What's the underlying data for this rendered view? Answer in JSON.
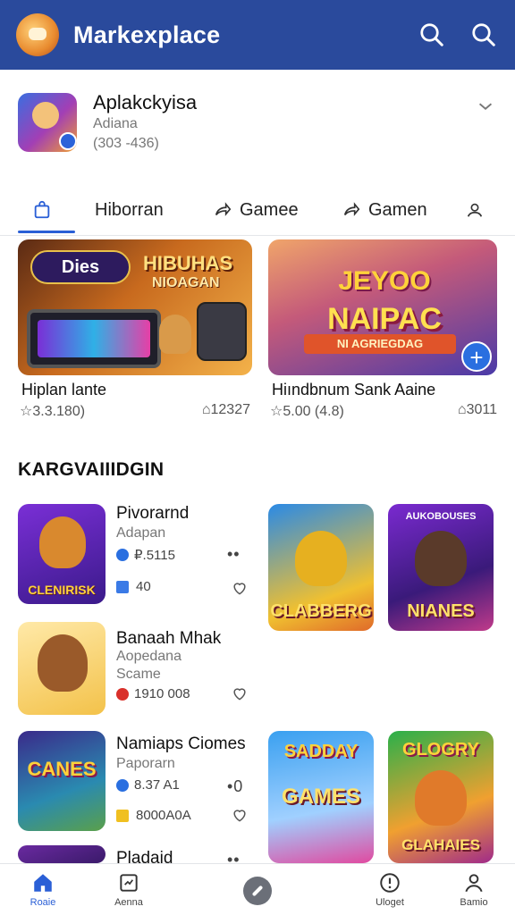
{
  "header": {
    "title": "Markexplace",
    "logo_icon": "mascot-logo-icon",
    "search_icon": "search-icon",
    "search2_icon": "search-icon"
  },
  "app": {
    "name": "Aplakckyisa",
    "developer": "Adiana",
    "count": "(303 -436)",
    "expand_icon": "chevron-down-icon"
  },
  "tabs": [
    {
      "label": "",
      "icon": "bag-icon",
      "active": true
    },
    {
      "label": "Hiborran"
    },
    {
      "label": "Gamee",
      "icon": "share-icon"
    },
    {
      "label": "Gamen",
      "icon": "share-icon"
    },
    {
      "label": "",
      "icon": "person-icon"
    }
  ],
  "featured": [
    {
      "badge": "Dies",
      "headline": "HIBUHAS",
      "subhead": "NIOAGAN",
      "title": "Hiplan lante",
      "rating": "3.3.180)",
      "downloads": "12327"
    },
    {
      "headline": "JEYOO",
      "subhead": "NAIPAC",
      "ribbon": "NI AGRIEGDAG",
      "title": "Hiındbnum Sank Aaine",
      "rating": "5.00 (4.8)",
      "downloads": "3011"
    }
  ],
  "section_title": "KARGVAIIIDGIN",
  "list": [
    {
      "name": "Pivorarnd",
      "sub1": "Adapan",
      "sub2": "",
      "stat1": "₽.5115",
      "stat2": "40",
      "more": "••",
      "thumb_label": "CLENIRISK"
    },
    {
      "name": "Banaah Mhak",
      "sub1": "Aopedana",
      "sub2": "Scame",
      "stat1": "1910 008",
      "stat2": "",
      "more": "",
      "thumb_label": ""
    },
    {
      "name": "Namiaps Ciomes",
      "sub1": "Paporarn",
      "sub2": "",
      "stat1": "8.37 A1",
      "stat2": "8000А0А",
      "more": "•0",
      "thumb_label": "CANES"
    },
    {
      "name": "Pladaid",
      "sub1": "",
      "sub2": "",
      "stat1": "",
      "stat2": "",
      "more": "••",
      "thumb_label": ""
    }
  ],
  "tiles": [
    {
      "label": "CLABBERG",
      "top": ""
    },
    {
      "label": "NIANES",
      "top": "AUKOBOUSES"
    },
    {
      "label": "GAMES",
      "top": "SADDAY"
    },
    {
      "label": "GLAHAIES",
      "top": "GLOGRY"
    }
  ],
  "nav": [
    {
      "label": "Roaie",
      "icon": "home-icon",
      "active": true
    },
    {
      "label": "Aenna",
      "icon": "badge-icon"
    },
    {
      "label": "",
      "icon": "compass-icon"
    },
    {
      "label": "Uloget",
      "icon": "alert-icon"
    },
    {
      "label": "Bamio",
      "icon": "person-icon"
    }
  ]
}
